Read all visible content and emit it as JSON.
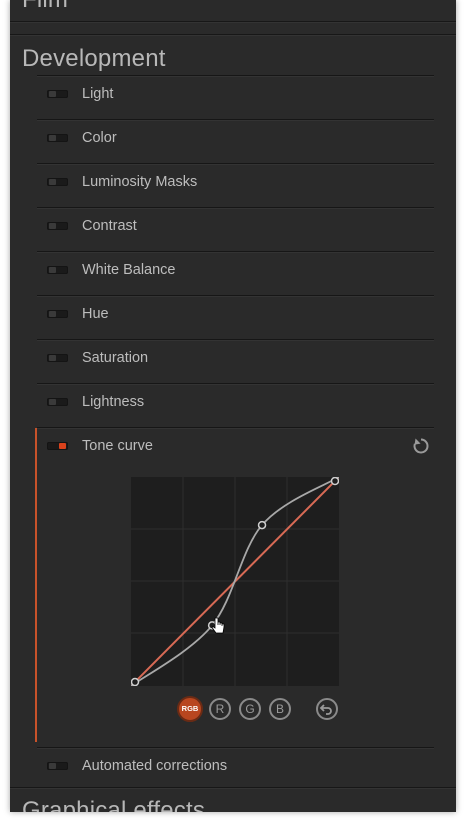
{
  "sections": {
    "film_label": "Film",
    "development_label": "Development",
    "graphical_effects_label": "Graphical effects"
  },
  "rows": [
    {
      "label": "Light",
      "enabled": false
    },
    {
      "label": "Color",
      "enabled": false
    },
    {
      "label": "Luminosity Masks",
      "enabled": false
    },
    {
      "label": "Contrast",
      "enabled": false
    },
    {
      "label": "White Balance",
      "enabled": false
    },
    {
      "label": "Hue",
      "enabled": false
    },
    {
      "label": "Saturation",
      "enabled": false
    },
    {
      "label": "Lightness",
      "enabled": false
    }
  ],
  "tone_curve": {
    "label": "Tone curve",
    "enabled": true,
    "reset_icon": "reset-icon",
    "curve_points": [
      [
        0,
        0
      ],
      [
        0.39,
        0.29
      ],
      [
        0.63,
        0.77
      ],
      [
        1,
        1
      ]
    ],
    "identity_line_color": "#d86a55",
    "curve_color": "#a8a8a8",
    "channels": [
      {
        "label": "RGB",
        "active": true
      },
      {
        "label": "R",
        "active": false
      },
      {
        "label": "G",
        "active": false
      },
      {
        "label": "B",
        "active": false
      }
    ],
    "undo_icon": "undo-icon"
  },
  "automated_corrections": {
    "label": "Automated corrections",
    "enabled": false
  },
  "colors": {
    "accent": "#c8522a",
    "panel_bg": "#2a2a2a",
    "text": "#bdbdbd"
  }
}
